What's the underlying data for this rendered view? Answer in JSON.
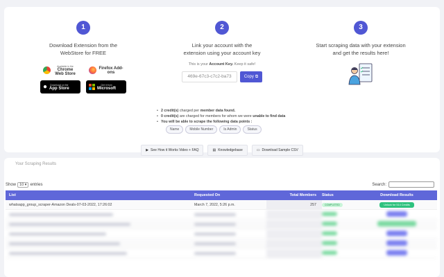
{
  "steps": [
    {
      "num": "1",
      "text": "Download Extension from the WebStore for FREE"
    },
    {
      "num": "2",
      "text": "Link your account with the extension using your account key"
    },
    {
      "num": "3",
      "text": "Start scraping data with your extension and get the results here!"
    }
  ],
  "stores": {
    "chrome": {
      "small": "Available in the",
      "label": "Chrome Web Store"
    },
    "firefox": {
      "small": "",
      "label": "Firefox Add-ons"
    },
    "apple": {
      "small": "Download on the",
      "label": "App Store"
    },
    "microsoft": {
      "small": "Get it from",
      "label": "Microsoft"
    }
  },
  "account": {
    "note_prefix": "This is your",
    "note_key": "Account Key.",
    "note_suffix": "Keep it safe!",
    "key_value": "469e-67c3-c7c2-ba73",
    "copy_label": "Copy"
  },
  "credits": {
    "line1_bold": "2 credit(s)",
    "line1_mid": "charged per",
    "line1_bold2": "member data found.",
    "line2_bold": "0 credit(s)",
    "line2_mid": "are charged for members for whom we were",
    "line2_bold2": "unable to find data",
    "line3": "You will be able to scrape the following data points :",
    "data_points": [
      "Name",
      "Mobile Number",
      "Is Admin",
      "Status"
    ]
  },
  "help_buttons": {
    "video": "See How it Works Video + FAQ",
    "kb": "Knowledgebase",
    "csv": "Download Sample CSV"
  },
  "results": {
    "section_title": "Your Scraping Results",
    "show_label": "Show",
    "show_value": "10",
    "entries_label": "entries",
    "search_label": "Search:",
    "columns": [
      "List",
      "Requested On",
      "Total Members",
      "Status",
      "Download Results"
    ],
    "first_row": {
      "list": "whatsapp_group_scraper-Amazon Deals-07-03-2022, 17:26:02",
      "requested": "March 7, 2022, 5:26 p.m.",
      "members": "257",
      "status": "COMPLETED",
      "download": "Unlock for 514 Credits"
    }
  },
  "colors": {
    "accent": "#5057d4",
    "header": "#5f67d9",
    "success": "#2ec27e"
  }
}
